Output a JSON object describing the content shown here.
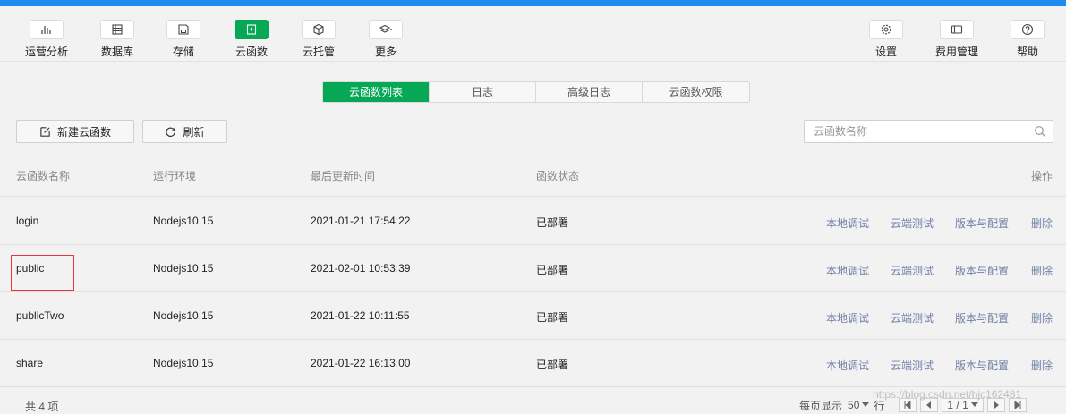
{
  "toolbar": {
    "left": [
      {
        "label": "运营分析",
        "icon": "bar-chart-icon"
      },
      {
        "label": "数据库",
        "icon": "database-icon"
      },
      {
        "label": "存储",
        "icon": "storage-icon"
      },
      {
        "label": "云函数",
        "icon": "cloud-function-icon",
        "active": true
      },
      {
        "label": "云托管",
        "icon": "cube-icon"
      },
      {
        "label": "更多",
        "icon": "layers-icon"
      }
    ],
    "right": [
      {
        "label": "设置",
        "icon": "gear-icon"
      },
      {
        "label": "费用管理",
        "icon": "wallet-icon"
      },
      {
        "label": "帮助",
        "icon": "help-icon"
      }
    ]
  },
  "tabs": [
    "云函数列表",
    "日志",
    "高级日志",
    "云函数权限"
  ],
  "actions": {
    "new_label": "新建云函数",
    "refresh_label": "刷新"
  },
  "search": {
    "placeholder": "云函数名称"
  },
  "table": {
    "headers": {
      "name": "云函数名称",
      "runtime": "运行环境",
      "updated": "最后更新时间",
      "status": "函数状态",
      "ops": "操作"
    },
    "ops": [
      "本地调试",
      "云端测试",
      "版本与配置",
      "删除"
    ],
    "rows": [
      {
        "name": "login",
        "runtime": "Nodejs10.15",
        "updated": "2021-01-21 17:54:22",
        "status": "已部署"
      },
      {
        "name": "public",
        "runtime": "Nodejs10.15",
        "updated": "2021-02-01 10:53:39",
        "status": "已部署",
        "highlighted": true
      },
      {
        "name": "publicTwo",
        "runtime": "Nodejs10.15",
        "updated": "2021-01-22 10:11:55",
        "status": "已部署"
      },
      {
        "name": "share",
        "runtime": "Nodejs10.15",
        "updated": "2021-01-22 16:13:00",
        "status": "已部署"
      }
    ]
  },
  "footer": {
    "count_text": "共 4 项",
    "per_page_label": "每页显示",
    "per_page_value": "50",
    "rows_suffix": "行",
    "page_text": "1 / 1"
  },
  "watermark": "https://blog.csdn.net/hjc162481",
  "colors": {
    "accent": "#07a855",
    "link": "#6e7fa6",
    "highlight_border": "#e8373b"
  }
}
